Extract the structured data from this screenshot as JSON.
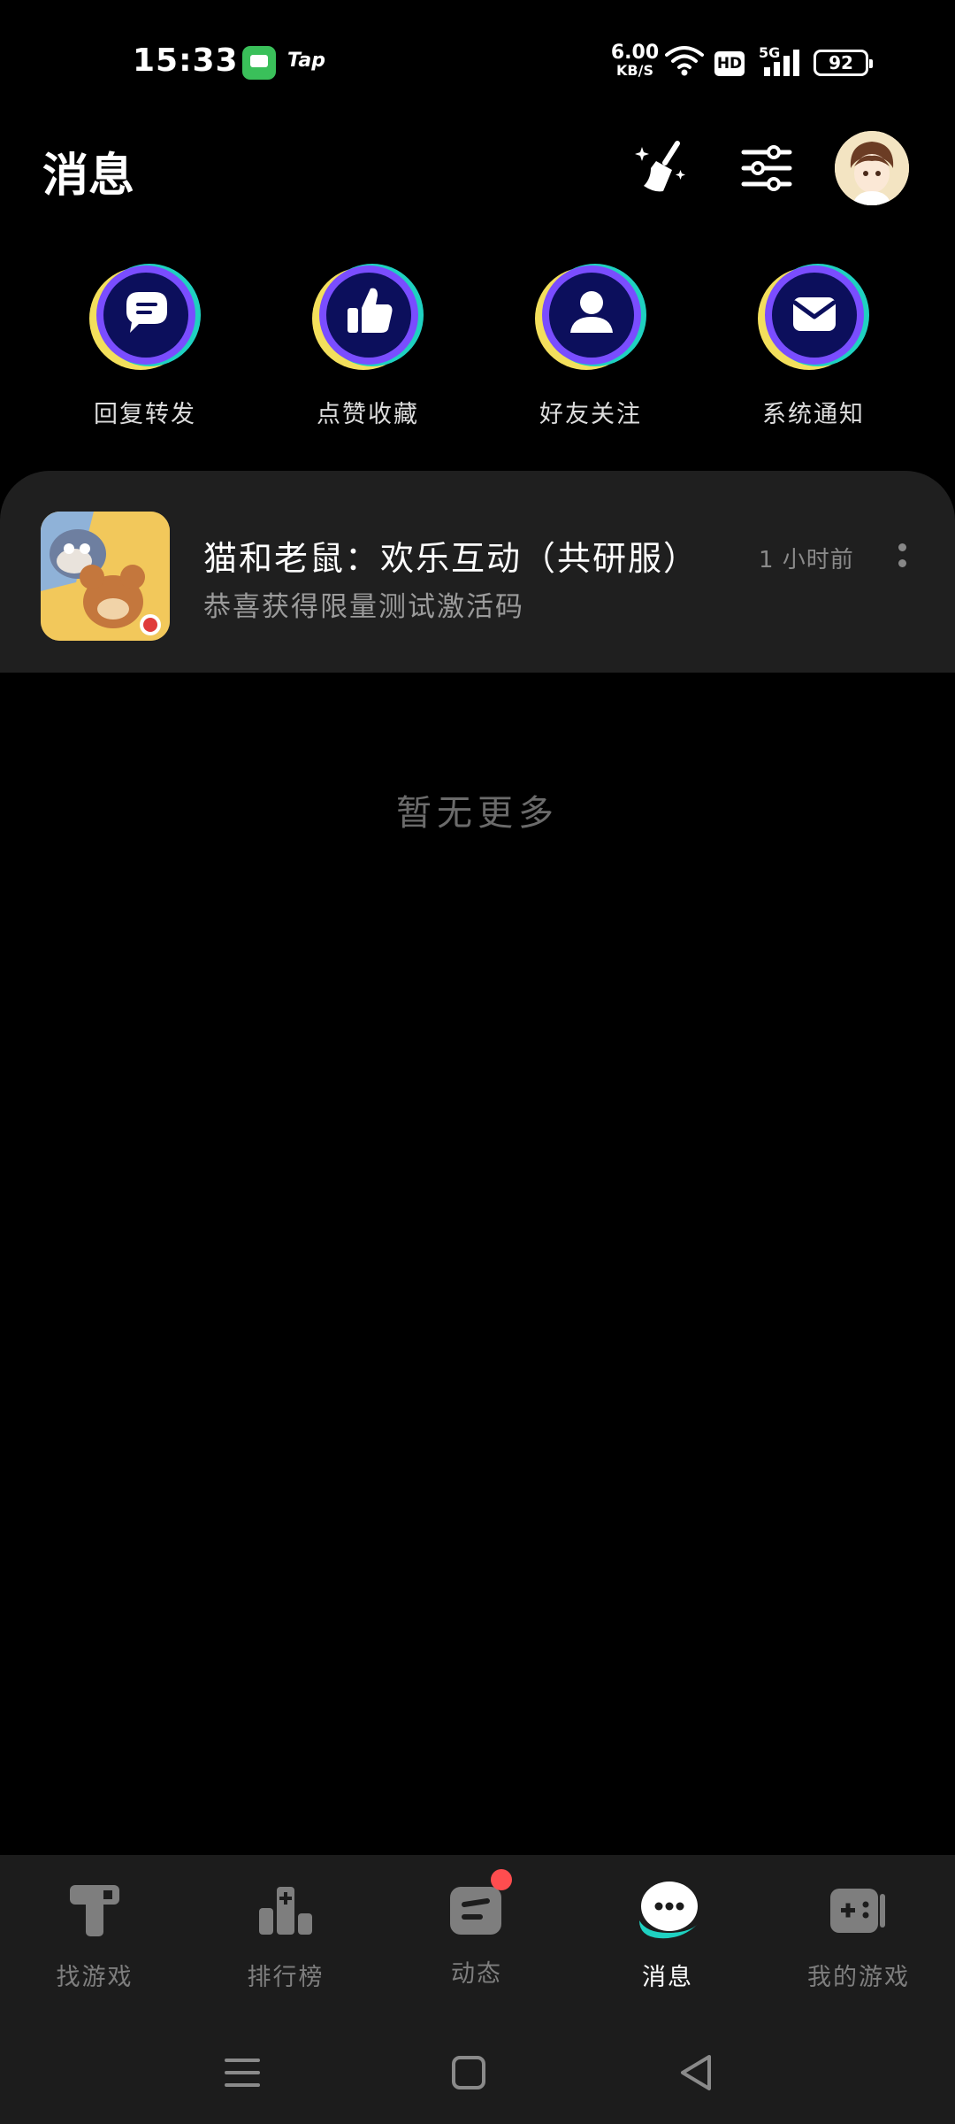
{
  "status_bar": {
    "time": "15:33",
    "app_label": "Tap",
    "net_speed_value": "6.00",
    "net_speed_unit": "KB/S",
    "hd": "HD",
    "network": "5G",
    "battery": "92"
  },
  "header": {
    "title": "消息"
  },
  "categories": [
    {
      "label": "回复转发",
      "icon": "chat-bubble-icon"
    },
    {
      "label": "点赞收藏",
      "icon": "thumbs-up-icon"
    },
    {
      "label": "好友关注",
      "icon": "person-icon"
    },
    {
      "label": "系统通知",
      "icon": "envelope-icon"
    }
  ],
  "messages": [
    {
      "title": "猫和老鼠：欢乐互动（共研服）",
      "subtitle": "恭喜获得限量测试激活码",
      "time": "1 小时前"
    }
  ],
  "empty_text": "暂无更多",
  "bottom_nav": [
    {
      "label": "找游戏",
      "icon": "find-game-icon",
      "active": false
    },
    {
      "label": "排行榜",
      "icon": "ranking-icon",
      "active": false
    },
    {
      "label": "动态",
      "icon": "feed-icon",
      "active": false,
      "badge": true
    },
    {
      "label": "消息",
      "icon": "message-icon",
      "active": true
    },
    {
      "label": "我的游戏",
      "icon": "gamepad-icon",
      "active": false
    }
  ],
  "colors": {
    "accent_teal": "#1fd1c1",
    "accent_purple": "#7a4dff",
    "accent_yellow": "#f3df5c",
    "icon_navy": "#0c0f5c",
    "badge_red": "#ff4d4f"
  }
}
